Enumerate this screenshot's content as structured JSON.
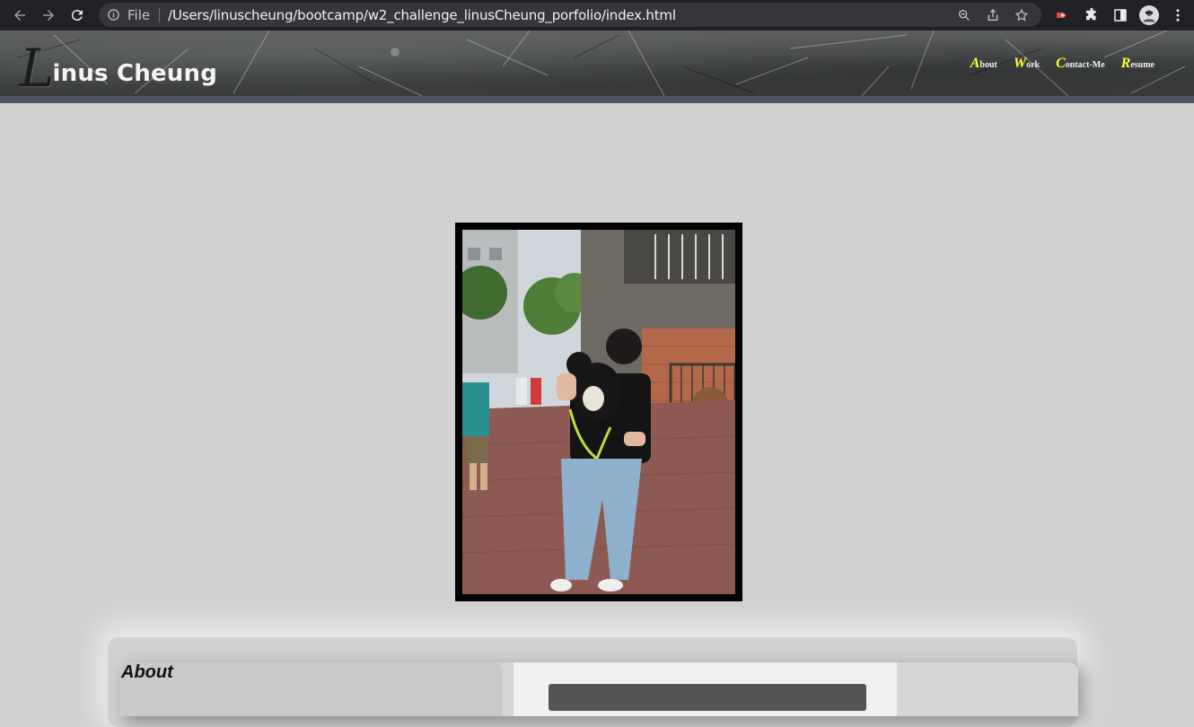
{
  "browser": {
    "scheme_label": "File",
    "url": "/Users/linuscheung/bootcamp/w2_challenge_linusCheung_porfolio/index.html"
  },
  "site": {
    "logo_initial": "L",
    "logo_rest": "inus Cheung",
    "nav": [
      {
        "cap": "A",
        "rest": "bout"
      },
      {
        "cap": "W",
        "rest": "ork"
      },
      {
        "cap": "C",
        "rest": "ontact-Me"
      },
      {
        "cap": "R",
        "rest": "esume"
      }
    ],
    "about_title": "About"
  },
  "colors": {
    "page_bg": "#d1d1cf",
    "nav_accent": "#ffff33",
    "header_bar": "#4b5563",
    "chrome_bg": "#202124"
  }
}
